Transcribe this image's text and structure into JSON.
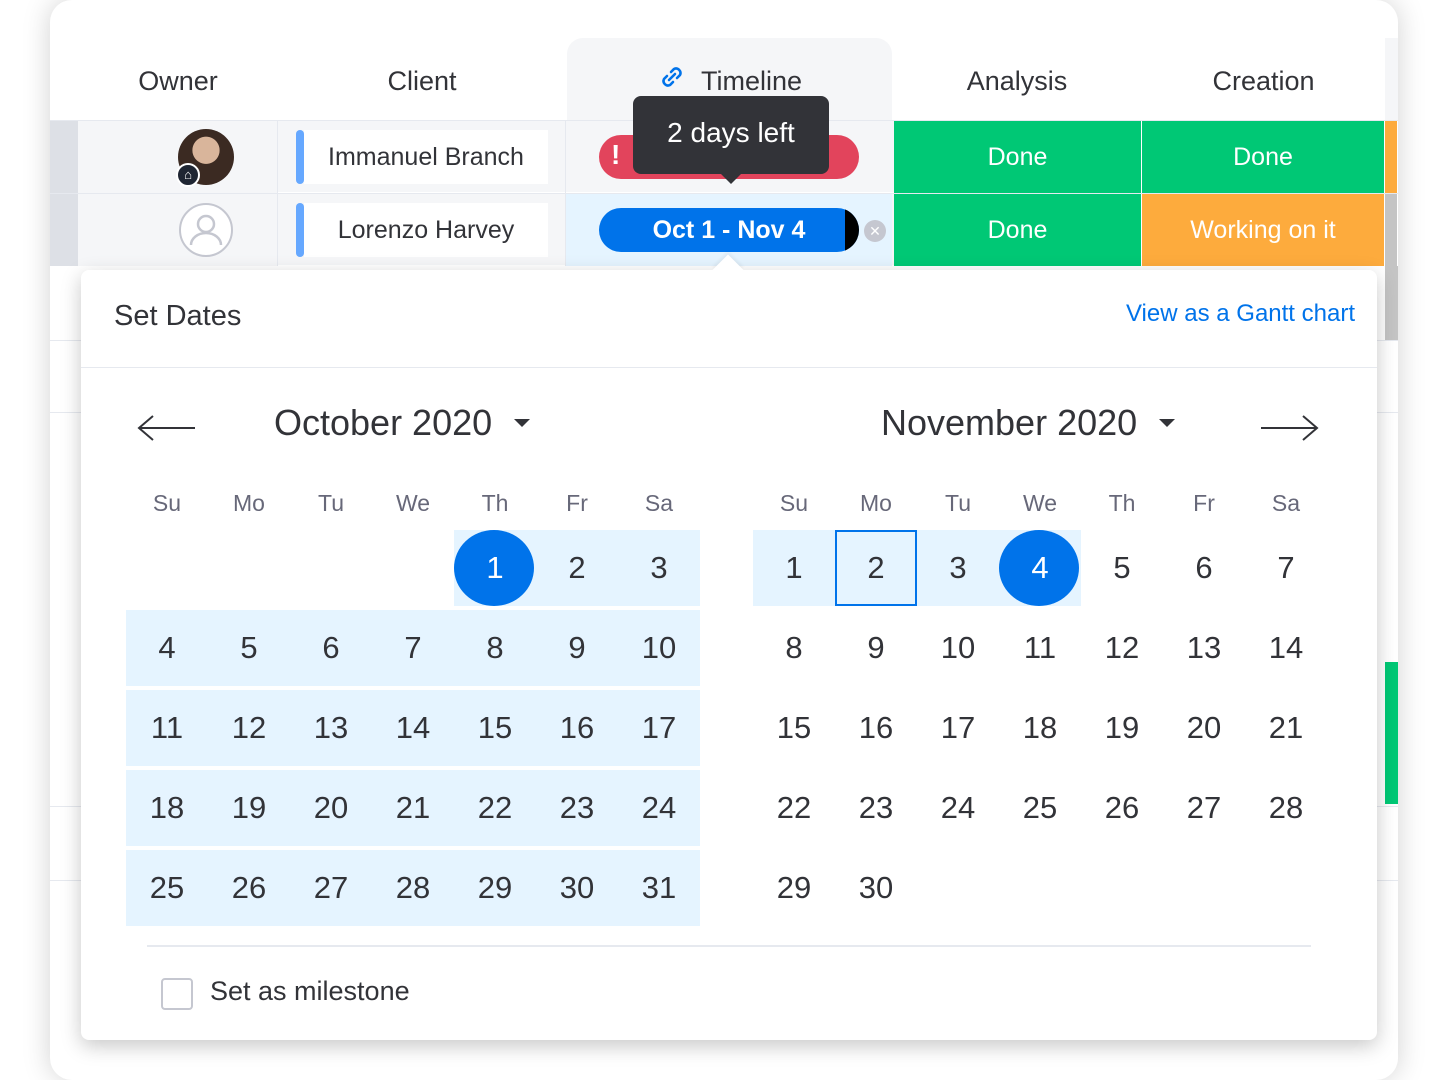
{
  "columns": {
    "owner": "Owner",
    "client": "Client",
    "timeline": "Timeline",
    "analysis": "Analysis",
    "creation": "Creation"
  },
  "rows": [
    {
      "client": "Immanuel Branch",
      "analysis": "Done",
      "creation": "Done"
    },
    {
      "client": "Lorenzo Harvey",
      "timeline": "Oct 1 - Nov 4",
      "analysis": "Done",
      "creation": "Working on it"
    }
  ],
  "tooltip": "2 days left",
  "popup": {
    "title": "Set Dates",
    "gantt_link": "View as a Gantt chart",
    "milestone_label": "Set as milestone",
    "left_month": "October 2020",
    "right_month": "November 2020",
    "weekdays": [
      "Su",
      "Mo",
      "Tu",
      "We",
      "Th",
      "Fr",
      "Sa"
    ],
    "selected_start": "1",
    "selected_end": "4",
    "focused_day": "2"
  },
  "colors": {
    "done": "#00c875",
    "working": "#fdab3d",
    "stuck": "#e2445c",
    "primary": "#0073ea",
    "range": "#e5f4ff"
  }
}
